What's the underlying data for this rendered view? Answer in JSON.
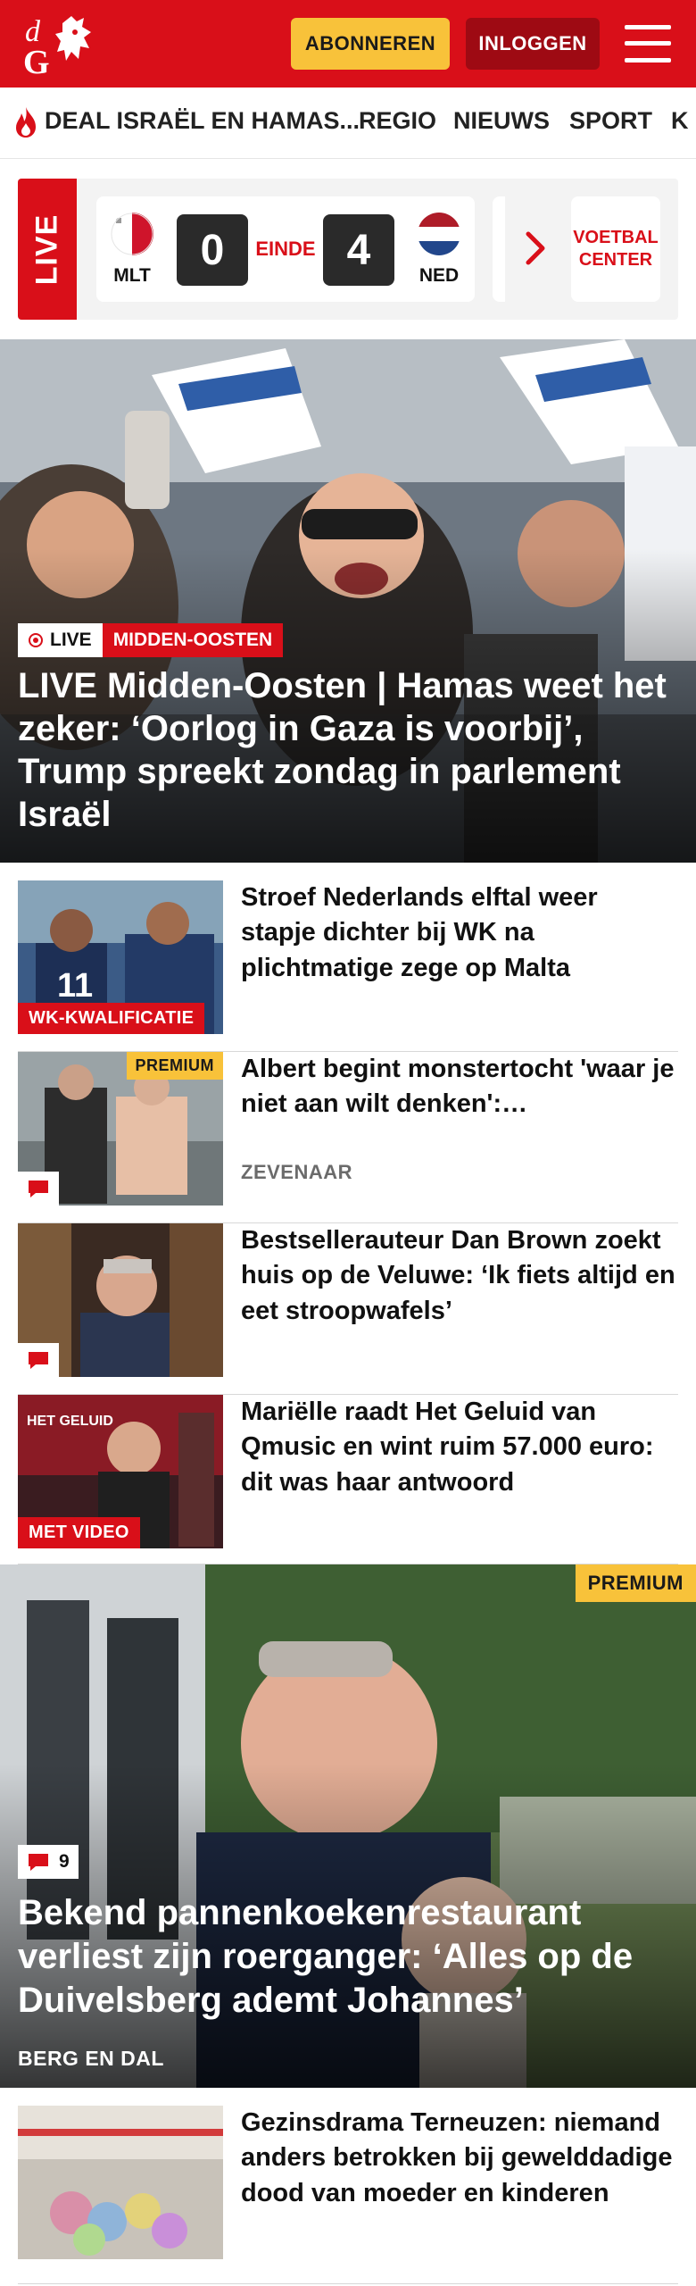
{
  "header": {
    "logo_text": "dG",
    "subscribe_label": "ABONNEREN",
    "login_label": "INLOGGEN",
    "brand_color": "#d90f19"
  },
  "nav": {
    "items": [
      {
        "label": "DEAL ISRAËL EN HAMAS...",
        "icon": "flame-icon"
      },
      {
        "label": "REGIO"
      },
      {
        "label": "NIEUWS"
      },
      {
        "label": "SPORT"
      },
      {
        "label": "K"
      }
    ]
  },
  "scores": {
    "live_label": "LIVE",
    "match": {
      "home_code": "MLT",
      "home_score": "0",
      "status": "EINDE",
      "away_score": "4",
      "away_code": "NED"
    },
    "voetbal_center_label": "VOETBAL CENTER"
  },
  "hero": {
    "live_badge": "LIVE",
    "category": "MIDDEN-OOSTEN",
    "title": "LIVE Midden-Oosten | Hamas weet het zeker: ‘Oorlog in Gaza is voorbij’, Trump spreekt zondag in parlement Israël"
  },
  "articles": [
    {
      "title": "Stroef Nederlands elftal weer stapje dichter bij WK na plichtmatige zege op Malta",
      "label": "WK-KWALIFICATIE"
    },
    {
      "title": "Albert begint monstertocht 'waar je niet aan wilt denken': 'Containerschip moet niet te dichtbij komen'",
      "premium": "PREMIUM",
      "location": "ZEVENAAR"
    },
    {
      "title": "Bestsellerauteur Dan Brown zoekt huis op de Veluwe: ‘Ik fiets altijd en eet stroopwafels’"
    },
    {
      "title": "Mariëlle raadt Het Geluid van Qmusic en wint ruim 57.000 euro: dit was haar antwoord",
      "label": "MET VIDEO",
      "thumb_text": "HET GELUID"
    }
  ],
  "feature": {
    "premium": "PREMIUM",
    "comment_count": "9",
    "title": "Bekend pannenkoekenrestaurant verliest zijn roerganger: ‘Alles op de Duivelsberg ademt Johannes’",
    "location": "BERG EN DAL"
  },
  "article_after": {
    "title": "Gezinsdrama Terneuzen: niemand anders betrokken bij gewelddadige dood van moeder en kinderen"
  }
}
